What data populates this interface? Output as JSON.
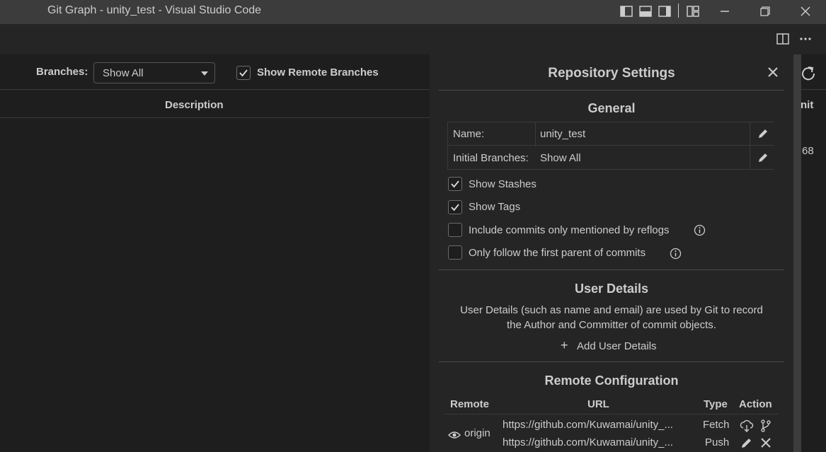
{
  "window": {
    "title": "Git Graph - unity_test - Visual Studio Code"
  },
  "toolbar": {
    "branches_label": "Branches:",
    "branches_value": "Show All",
    "show_remote_label": "Show Remote Branches",
    "show_remote_checked": true
  },
  "table": {
    "description_header": "Description",
    "peek_header": "nit",
    "peek_value": "68"
  },
  "settings": {
    "title": "Repository Settings",
    "general": {
      "title": "General",
      "name_label": "Name:",
      "name_value": "unity_test",
      "initial_branches_label": "Initial Branches:",
      "initial_branches_value": "Show All",
      "options": [
        {
          "label": "Show Stashes",
          "checked": true
        },
        {
          "label": "Show Tags",
          "checked": true
        },
        {
          "label": "Include commits only mentioned by reflogs",
          "checked": false
        },
        {
          "label": "Only follow the first parent of commits",
          "checked": false
        }
      ]
    },
    "user_details": {
      "title": "User Details",
      "description_line1": "User Details (such as name and email) are used by Git to record",
      "description_line2": "the Author and Committer of commit objects.",
      "add_label": "Add User Details"
    },
    "remote_config": {
      "title": "Remote Configuration",
      "headers": {
        "remote": "Remote",
        "url": "URL",
        "type": "Type",
        "action": "Action"
      },
      "remote_name": "origin",
      "rows": [
        {
          "url": "https://github.com/Kuwamai/unity_...",
          "type": "Fetch"
        },
        {
          "url": "https://github.com/Kuwamai/unity_...",
          "type": "Push"
        }
      ]
    }
  },
  "colors": {
    "titlebar": "#3c3c3c",
    "editor_bg": "#1e1e1e",
    "panel_bg": "#252526",
    "text": "#cccccc"
  }
}
